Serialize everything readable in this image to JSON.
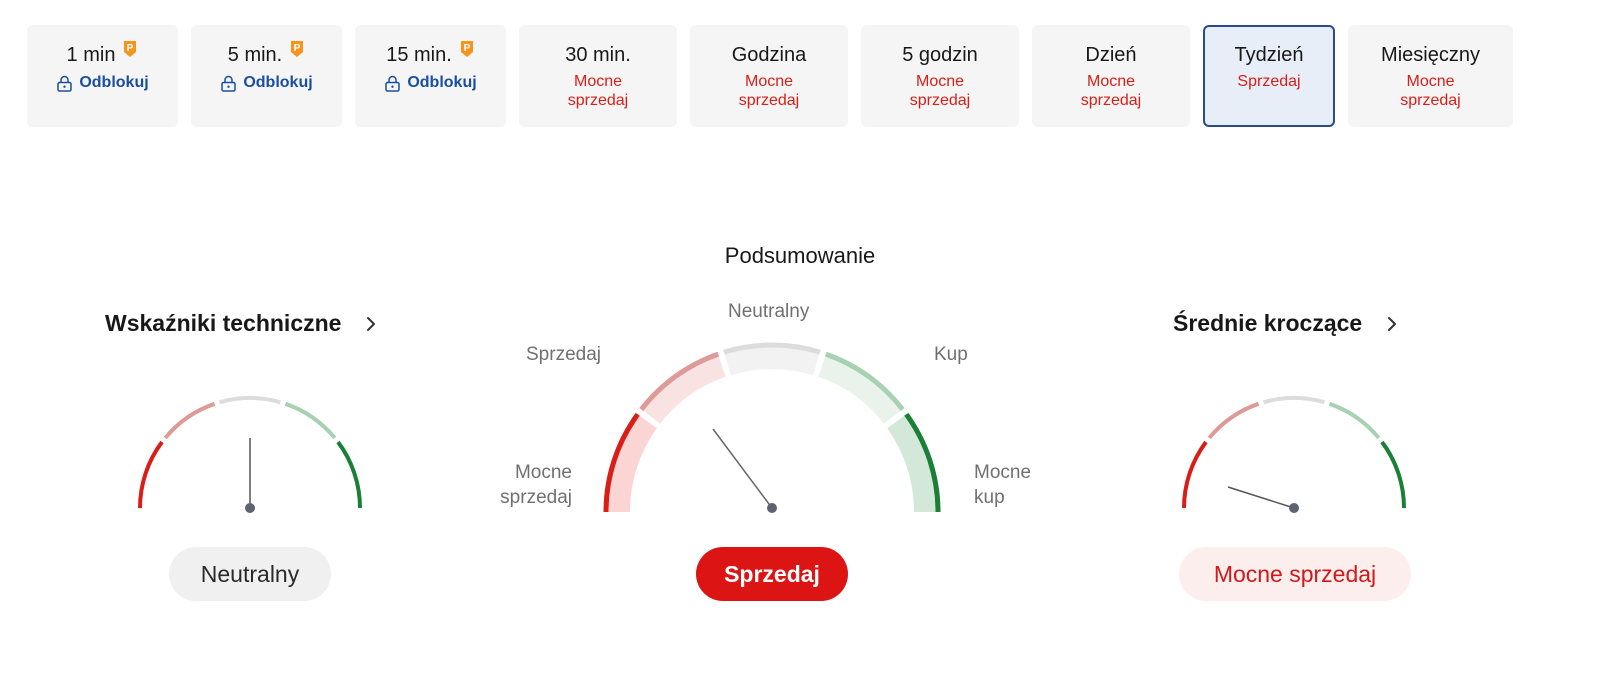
{
  "timeframes": [
    {
      "label": "1 min",
      "locked": true,
      "unlock_label": "Odblokuj"
    },
    {
      "label": "5 min.",
      "locked": true,
      "unlock_label": "Odblokuj"
    },
    {
      "label": "15 min.",
      "locked": true,
      "unlock_label": "Odblokuj"
    },
    {
      "label": "30 min.",
      "status": "Mocne sprzedaj"
    },
    {
      "label": "Godzina",
      "status": "Mocne sprzedaj"
    },
    {
      "label": "5 godzin",
      "status": "Mocne sprzedaj"
    },
    {
      "label": "Dzień",
      "status": "Mocne sprzedaj"
    },
    {
      "label": "Tydzień",
      "status": "Sprzedaj",
      "active": true
    },
    {
      "label": "Miesięczny",
      "status": "Mocne sprzedaj"
    }
  ],
  "summary": {
    "title": "Podsumowanie",
    "labels": {
      "strong_sell": "Mocne sprzedaj",
      "sell": "Sprzedaj",
      "neutral": "Neutralny",
      "buy": "Kup",
      "strong_buy": "Mocne kup"
    },
    "result": "Sprzedaj"
  },
  "technical": {
    "title": "Wskaźniki techniczne",
    "result": "Neutralny"
  },
  "moving_averages": {
    "title": "Średnie kroczące",
    "result": "Mocne sprzedaj"
  },
  "colors": {
    "strong_sell": "#d91e18",
    "sell": "#dd9a97",
    "neutral": "#dcdcdc",
    "buy": "#a8d1b1",
    "strong_buy": "#1a7f37",
    "link": "#1a4fa0",
    "pro": "#f7941d"
  },
  "icons": {
    "pro": "pro-badge-icon",
    "lock": "lock-icon",
    "chevron": "chevron-right-icon"
  }
}
